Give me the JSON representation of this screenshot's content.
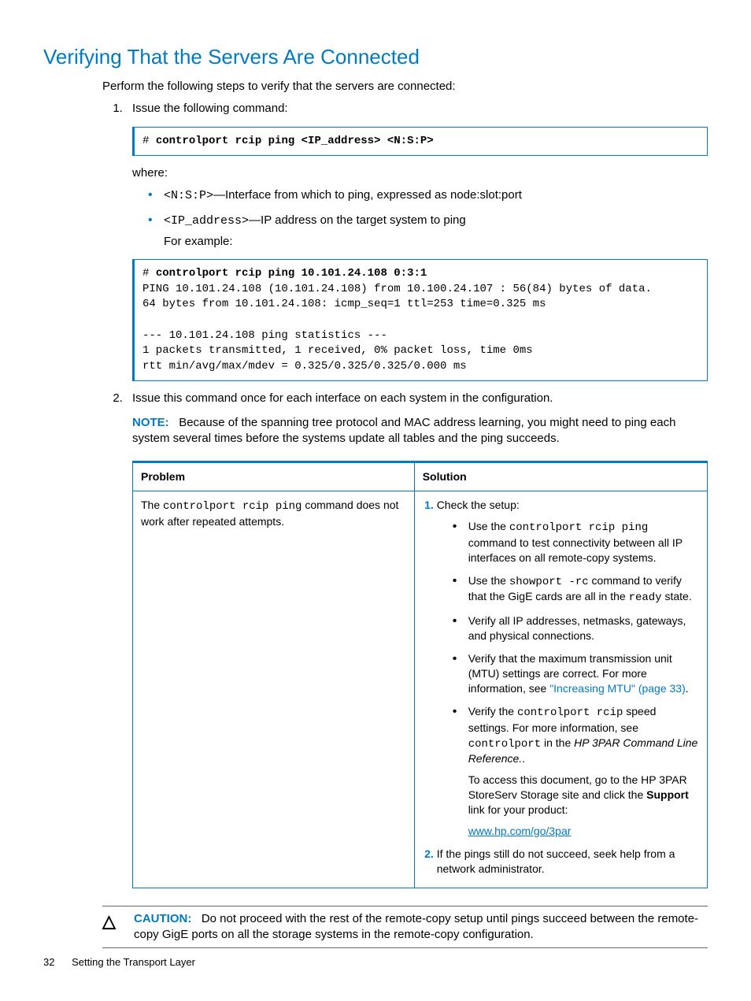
{
  "title": "Verifying That the Servers Are Connected",
  "intro": "Perform the following steps to verify that the servers are connected:",
  "step1": {
    "text": "Issue the following command:",
    "cmd_prompt": "# ",
    "cmd": "controlport rcip ping <IP_address> <N:S:P>",
    "where_label": "where:",
    "bullet1_code": "<N:S:P>",
    "bullet1_desc": "—Interface from which to ping, expressed as node:slot:port",
    "bullet2_code": "<IP_address>",
    "bullet2_desc": "—IP address on the target system to ping",
    "for_example": "For example:",
    "example_prompt": "# ",
    "example_cmd": "controlport rcip ping 10.101.24.108 0:3:1",
    "example_out": "PING 10.101.24.108 (10.101.24.108) from 10.100.24.107 : 56(84) bytes of data.\n64 bytes from 10.101.24.108: icmp_seq=1 ttl=253 time=0.325 ms\n\n--- 10.101.24.108 ping statistics ---\n1 packets transmitted, 1 received, 0% packet loss, time 0ms\nrtt min/avg/max/mdev = 0.325/0.325/0.325/0.000 ms"
  },
  "step2": {
    "text": "Issue this command once for each interface on each system in the configuration.",
    "note_label": "NOTE:",
    "note_text": "Because of the spanning tree protocol and MAC address learning, you might need to ping each system several times before the systems update all tables and the ping succeeds."
  },
  "table": {
    "h_problem": "Problem",
    "h_solution": "Solution",
    "problem_pre": "The ",
    "problem_code": "controlport rcip ping",
    "problem_post": " command does not work after repeated attempts.",
    "sol1": "Check the setup:",
    "sol1_b1_a": "Use the ",
    "sol1_b1_code": "controlport rcip ping",
    "sol1_b1_b": " command to test connectivity between all IP interfaces on all remote-copy systems.",
    "sol1_b2_a": "Use the ",
    "sol1_b2_code": "showport -rc",
    "sol1_b2_b": " command to verify that the GigE cards are all in the ",
    "sol1_b2_code2": "ready",
    "sol1_b2_c": " state.",
    "sol1_b3": "Verify all IP addresses, netmasks, gateways, and physical connections.",
    "sol1_b4_a": "Verify that the maximum transmission unit (MTU) settings are correct. For more information, see ",
    "sol1_b4_link": "\"Increasing MTU\" (page 33)",
    "sol1_b4_b": ".",
    "sol1_b5_a": "Verify the ",
    "sol1_b5_code": "controlport rcip",
    "sol1_b5_b": " speed settings. For more information, see ",
    "sol1_b5_code2": "controlport",
    "sol1_b5_c": " in the ",
    "sol1_b5_italic": "HP 3PAR Command Line Reference.",
    "sol1_b5_d": ".",
    "sol1_p2_a": "To access this document, go to the HP 3PAR StoreServ Storage site and click the ",
    "sol1_p2_bold": "Support",
    "sol1_p2_b": " link for your product:",
    "sol1_link": "www.hp.com/go/3par",
    "sol2": "If the pings still do not succeed, seek help from a network administrator."
  },
  "caution": {
    "icon": "△",
    "label": "CAUTION:",
    "text": "Do not proceed with the rest of the remote-copy setup until pings succeed between the remote-copy GigE ports on all the storage systems in the remote-copy configuration."
  },
  "footer": {
    "page": "32",
    "chapter": "Setting the Transport Layer"
  }
}
